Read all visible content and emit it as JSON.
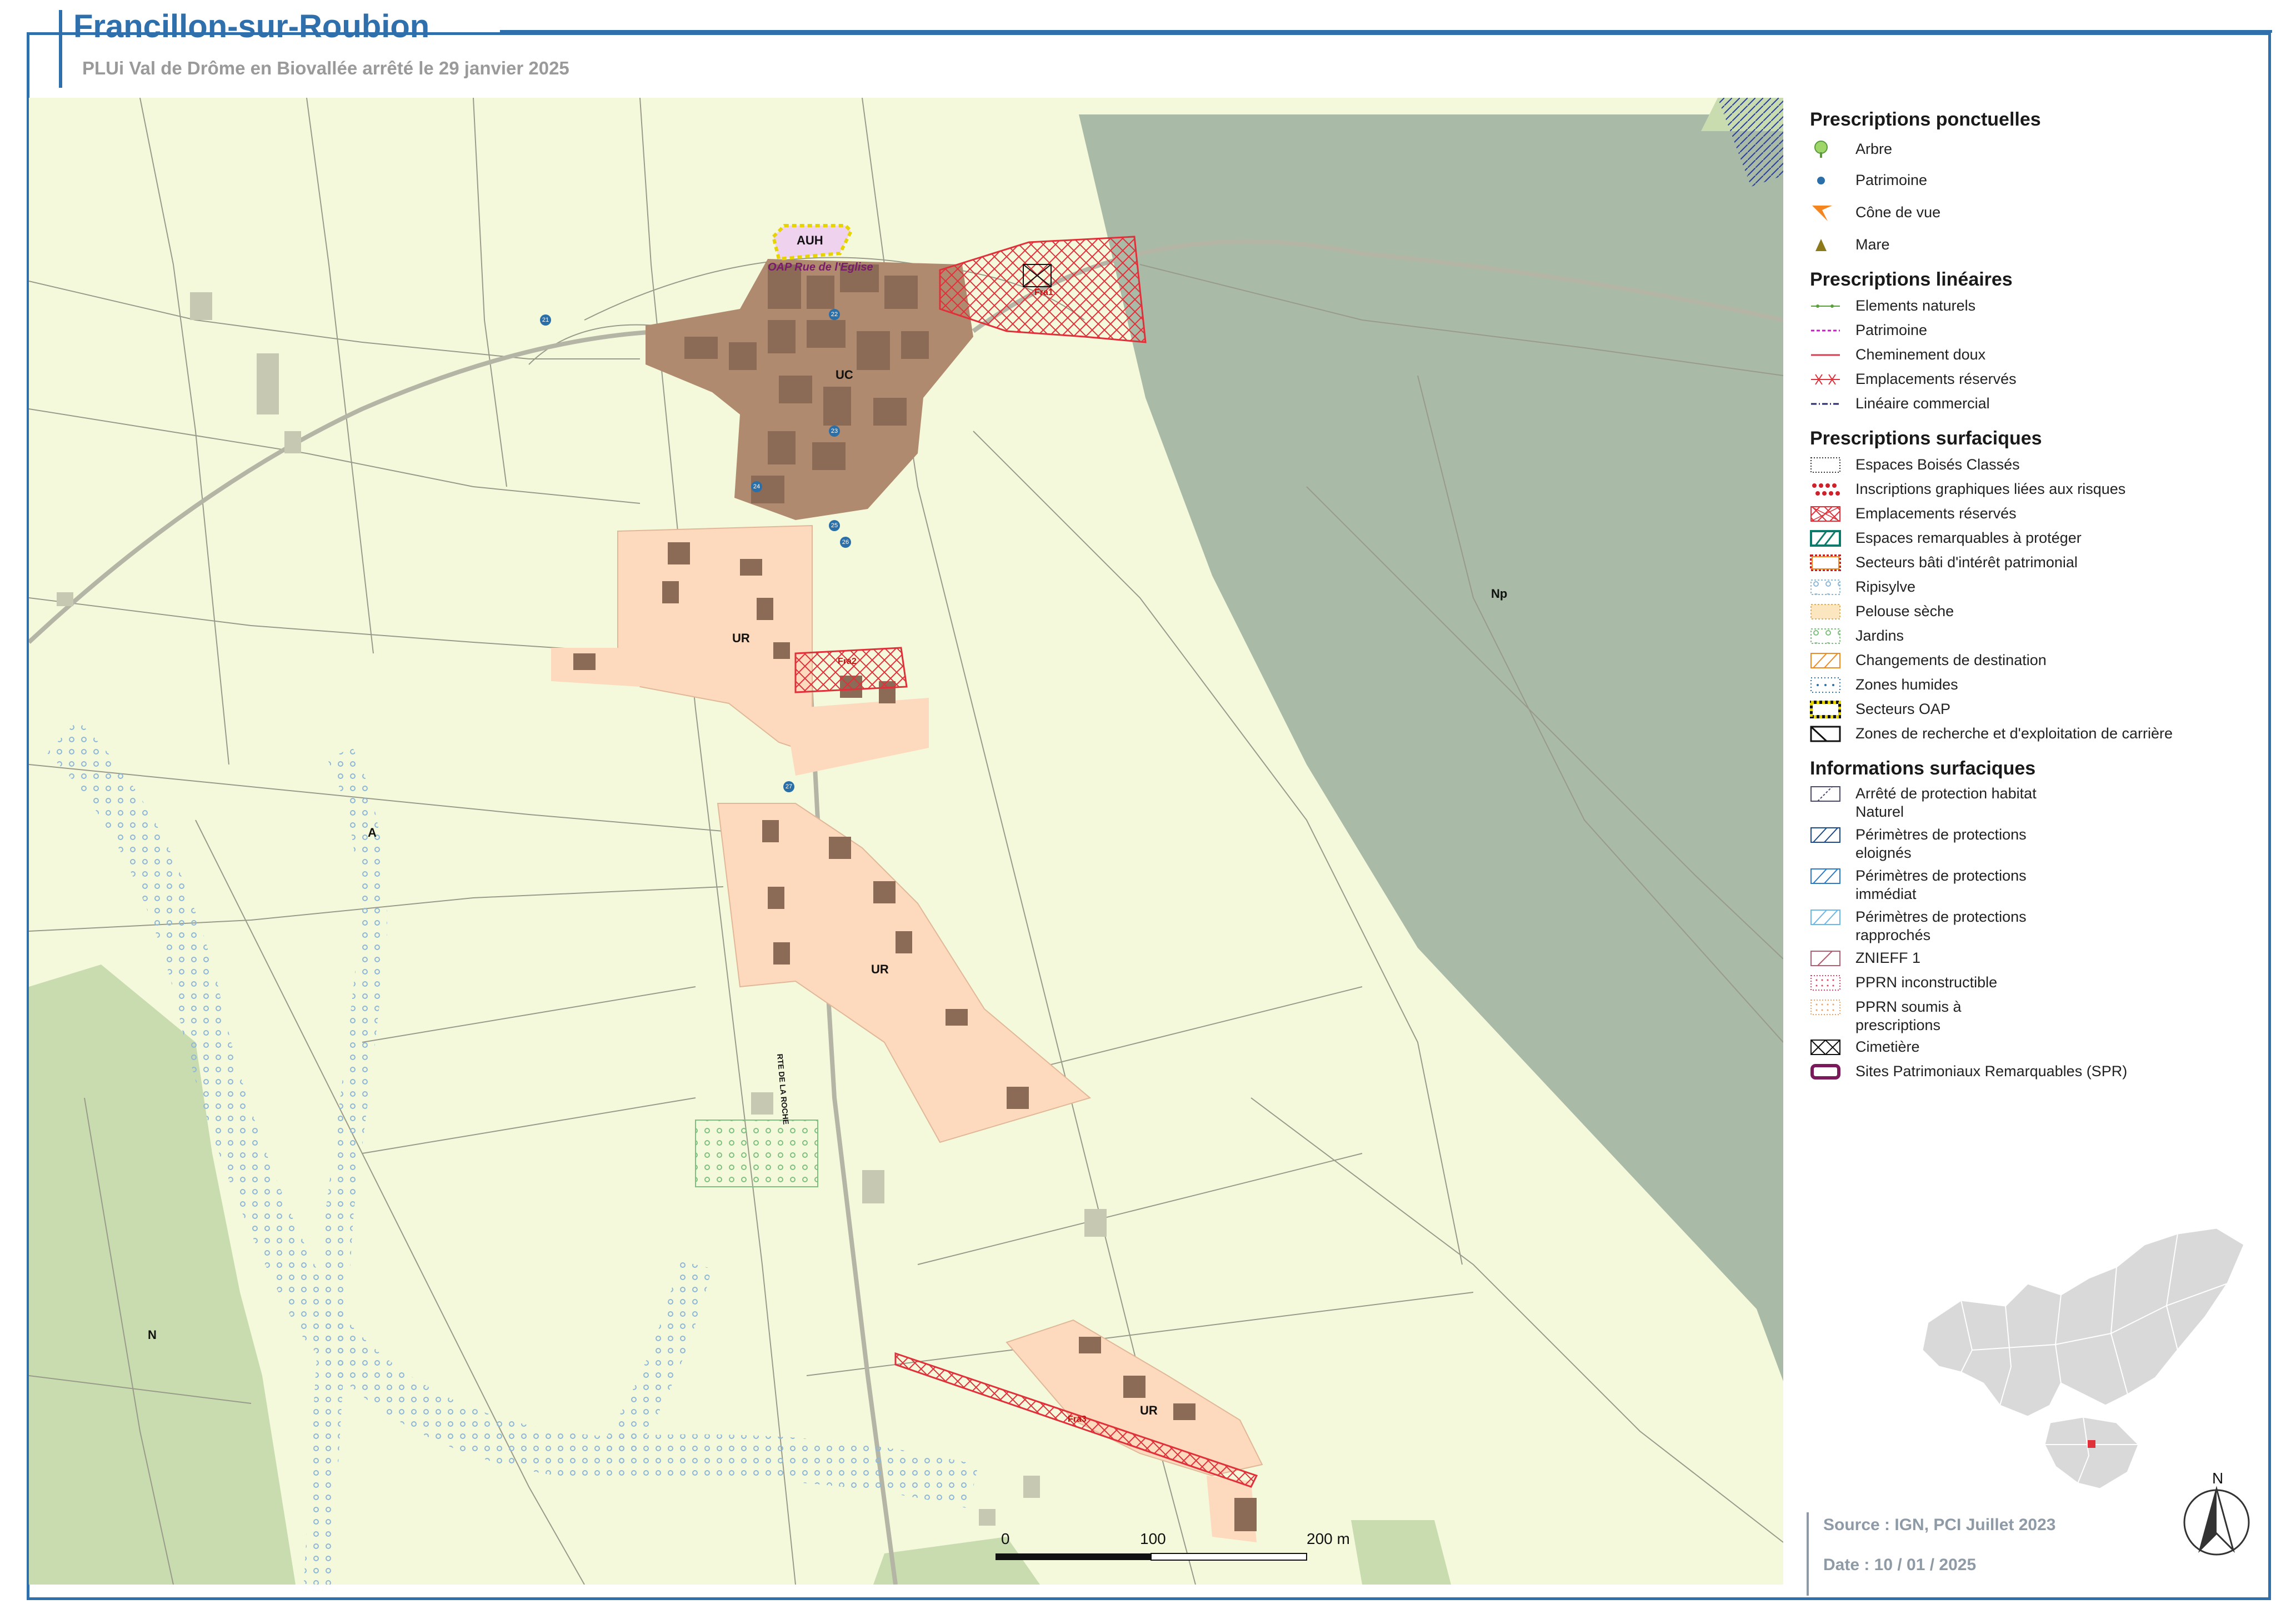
{
  "header": {
    "title": "Francillon-sur-Roubion",
    "subtitle": "PLUi Val de Drôme en Biovallée arrêté le 29 janvier 2025"
  },
  "map": {
    "zones": {
      "auh": "AUH",
      "oap": "OAP Rue de l'Eglise",
      "uc": "UC",
      "ur1": "UR",
      "ur2": "UR",
      "ur3": "UR",
      "np": "Np",
      "a": "A",
      "n": "N"
    },
    "reserved": {
      "fra1": "Fra1",
      "fra2": "Fra2",
      "fra3": "Fra3"
    },
    "road_label": "RTE DE LA ROCHE",
    "markers": [
      "21",
      "22",
      "23",
      "24",
      "25",
      "26",
      "27"
    ],
    "scale": {
      "s0": "0",
      "s1": "100",
      "s2": "200 m"
    },
    "colors": {
      "background": "#f5f9dc",
      "zone_uc": "#b08a6e",
      "zone_ur": "#fdd9bd",
      "zone_np": "#a9baa6",
      "zone_n": "#c9dcb0",
      "building": "#8b6b55",
      "reserved": "#e0303a",
      "frame": "#2f6fab"
    }
  },
  "legend": {
    "ponctuelles": {
      "title": "Prescriptions ponctuelles",
      "items": [
        "Arbre",
        "Patrimoine",
        "Cône de vue",
        "Mare"
      ]
    },
    "lineaires": {
      "title": "Prescriptions linéaires",
      "items": [
        "Elements naturels",
        "Patrimoine",
        "Cheminement doux",
        "Emplacements réservés",
        "Linéaire commercial"
      ]
    },
    "surfaciques": {
      "title": "Prescriptions surfaciques",
      "items": [
        "Espaces Boisés Classés",
        "Inscriptions graphiques liées aux risques",
        "Emplacements réservés",
        "Espaces remarquables à protéger",
        "Secteurs bâti d'intérêt patrimonial",
        "Ripisylve",
        "Pelouse sèche",
        "Jardins",
        "Changements de destination",
        "Zones humides",
        "Secteurs OAP",
        "Zones de recherche et d'exploitation de carrière"
      ]
    },
    "informations": {
      "title": "Informations surfaciques",
      "items": [
        "Arrêté de protection habitat Naturel",
        "Périmètres de protections eloignés",
        "Périmètres de protections immédiat",
        "Périmètres de protections rapprochés",
        "ZNIEFF 1",
        "PPRN inconstructible",
        "PPRN soumis à prescriptions",
        "Cimetière",
        "Sites Patrimoniaux Remarquables (SPR)"
      ]
    }
  },
  "footer": {
    "source": "Source : IGN, PCI Juillet 2023",
    "date": "Date : 10 / 01 / 2025",
    "north": "N"
  }
}
